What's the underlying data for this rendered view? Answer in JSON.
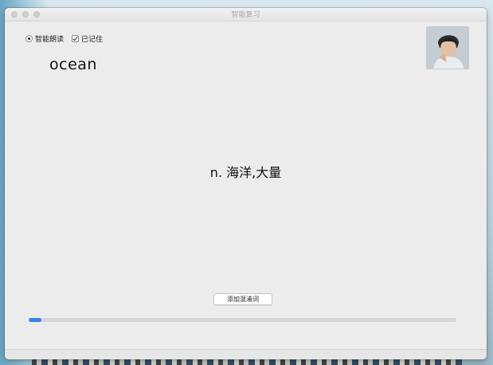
{
  "window": {
    "title": "智能复习"
  },
  "options": {
    "smart_read": {
      "label": "智能朗读",
      "selected": true
    },
    "memorized": {
      "label": "已记住",
      "checked": true
    }
  },
  "card": {
    "word": "ocean",
    "meaning": "n. 海洋,大量"
  },
  "actions": {
    "add_confusion_label": "添加混淆词"
  },
  "progress": {
    "value": 0.03,
    "color": "#3a82e6"
  },
  "avatar": {
    "icon": "user-photo-icon"
  }
}
